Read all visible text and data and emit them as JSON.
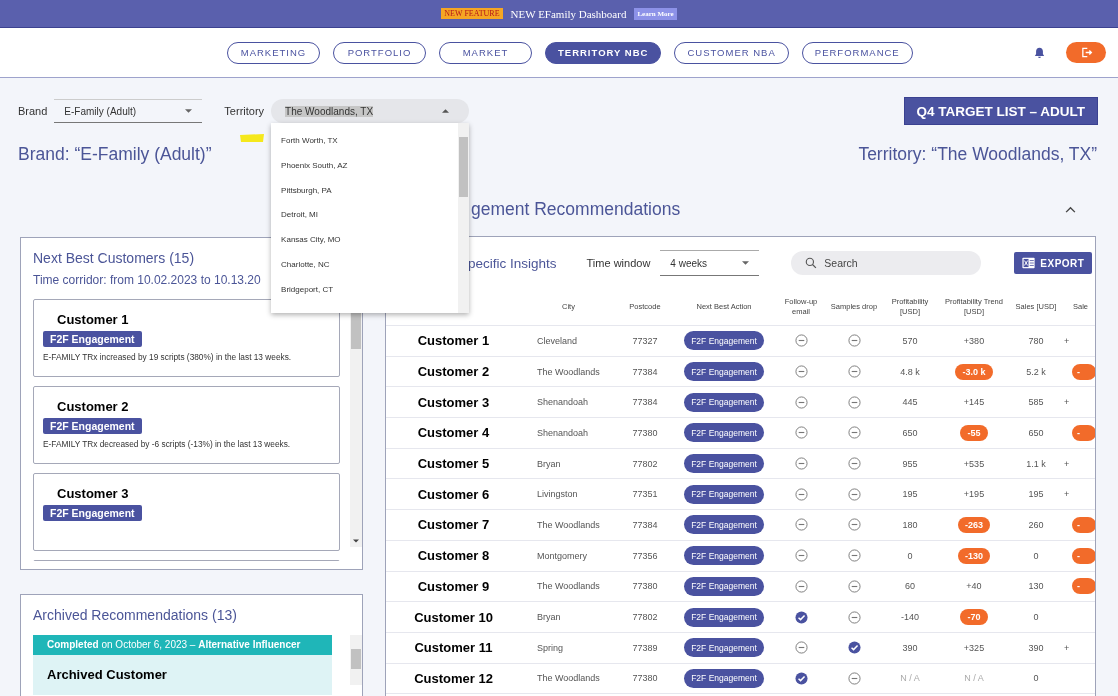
{
  "banner": {
    "badge": "NEW FEATURE",
    "text": "NEW EFamily Dashboard",
    "link": "Learn More"
  },
  "nav": {
    "tabs": [
      {
        "label": "MARKETING",
        "selected": false
      },
      {
        "label": "PORTFOLIO",
        "selected": false
      },
      {
        "label": "MARKET",
        "selected": false
      },
      {
        "label": "TERRITORY NBC",
        "selected": true
      },
      {
        "label": "CUSTOMER NBA",
        "selected": false
      },
      {
        "label": "PERFORMANCE",
        "selected": false
      }
    ]
  },
  "filters": {
    "brand": {
      "label": "Brand",
      "value": "E-Family (Adult)"
    },
    "territory": {
      "label": "Territory",
      "value": "The Woodlands, TX",
      "expanded": true,
      "options": [
        "Forth Worth, TX",
        "Phoenix South, AZ",
        "Pittsburgh, PA",
        "Detroit, MI",
        "Kansas City, MO",
        "Charlotte, NC",
        "Bridgeport, CT"
      ]
    }
  },
  "target_button": "Q4 TARGET LIST – ADULT",
  "brand_heading": "Brand: “E-Family (Adult)”",
  "territory_heading": "Territory: “The Woodlands, TX”",
  "section": {
    "title": "gement Recommendations",
    "expanded": true
  },
  "next_best": {
    "title": "Next Best Customers (15)",
    "subtitle": "Time corridor: from 10.02.2023 to 10.13.20",
    "cards": [
      {
        "name": "Customer 1",
        "action": "F2F Engagement",
        "note": "E-FAMILY TRx increased by 19 scripts (380%) in the last 13 weeks."
      },
      {
        "name": "Customer 2",
        "action": "F2F Engagement",
        "note": "E-FAMILY TRx decreased by -6 scripts (-13%) in the last 13 weeks."
      },
      {
        "name": "Customer 3",
        "action": "F2F Engagement"
      }
    ]
  },
  "archived": {
    "title": "Archived Recommendations (13)",
    "items": [
      {
        "header": "**Completed** on October 6, 2023 – **Alternative Influencer**",
        "name": "Archived Customer"
      }
    ]
  },
  "insights": {
    "title": "pecific Insights",
    "time_window": {
      "label": "Time window",
      "value": "4 weeks"
    },
    "search": {
      "placeholder": "Search"
    },
    "export": "EXPORT",
    "columns": [
      "City",
      "Postcode",
      "Next Best Action",
      "Follow-up email",
      "Samples drop",
      "Profitability [USD]",
      "Profitability Trend [USD]",
      "Sales [USD]",
      "Sale"
    ],
    "rows": [
      {
        "name": "Customer 1",
        "city": "Cleveland",
        "postcode": "77327",
        "action": "F2F Engagement",
        "followup_checked": false,
        "samples_checked": false,
        "profitability": "570",
        "trend": "+380",
        "trend_negative": false,
        "sales": "780",
        "column_10": {
          "text": "+",
          "negative": false
        }
      },
      {
        "name": "Customer 2",
        "city": "The Woodlands",
        "postcode": "77384",
        "action": "F2F Engagement",
        "followup_checked": false,
        "samples_checked": false,
        "profitability": "4.8 k",
        "trend": "-3.0 k",
        "trend_negative": true,
        "sales": "5.2 k",
        "column_10": {
          "text": "-",
          "negative": true
        }
      },
      {
        "name": "Customer 3",
        "city": "Shenandoah",
        "postcode": "77384",
        "action": "F2F Engagement",
        "followup_checked": false,
        "samples_checked": false,
        "profitability": "445",
        "trend": "+145",
        "trend_negative": false,
        "sales": "585",
        "column_10": {
          "text": "+",
          "negative": false
        }
      },
      {
        "name": "Customer 4",
        "city": "Shenandoah",
        "postcode": "77380",
        "action": "F2F Engagement",
        "followup_checked": false,
        "samples_checked": false,
        "profitability": "650",
        "trend": "-55",
        "trend_negative": true,
        "sales": "650",
        "column_10": {
          "text": "-",
          "negative": true
        }
      },
      {
        "name": "Customer 5",
        "city": "Bryan",
        "postcode": "77802",
        "action": "F2F Engagement",
        "followup_checked": false,
        "samples_checked": false,
        "profitability": "955",
        "trend": "+535",
        "trend_negative": false,
        "sales": "1.1 k",
        "column_10": {
          "text": "+",
          "negative": false
        }
      },
      {
        "name": "Customer 6",
        "city": "Livingston",
        "postcode": "77351",
        "action": "F2F Engagement",
        "followup_checked": false,
        "samples_checked": false,
        "profitability": "195",
        "trend": "+195",
        "trend_negative": false,
        "sales": "195",
        "column_10": {
          "text": "+",
          "negative": false
        }
      },
      {
        "name": "Customer 7",
        "city": "The Woodlands",
        "postcode": "77384",
        "action": "F2F Engagement",
        "followup_checked": false,
        "samples_checked": false,
        "profitability": "180",
        "trend": "-263",
        "trend_negative": true,
        "sales": "260",
        "column_10": {
          "text": "-",
          "negative": true
        }
      },
      {
        "name": "Customer 8",
        "city": "Montgomery",
        "postcode": "77356",
        "action": "F2F Engagement",
        "followup_checked": false,
        "samples_checked": false,
        "profitability": "0",
        "trend": "-130",
        "trend_negative": true,
        "sales": "0",
        "column_10": {
          "text": "-",
          "negative": true
        }
      },
      {
        "name": "Customer 9",
        "city": "The Woodlands",
        "postcode": "77380",
        "action": "F2F Engagement",
        "followup_checked": false,
        "samples_checked": false,
        "profitability": "60",
        "trend": "+40",
        "trend_negative": false,
        "sales": "130",
        "column_10": {
          "text": "-",
          "negative": true
        }
      },
      {
        "name": "Customer 10",
        "city": "Bryan",
        "postcode": "77802",
        "action": "F2F Engagement",
        "followup_checked": true,
        "samples_checked": false,
        "profitability": "-140",
        "trend": "-70",
        "trend_negative": true,
        "sales": "0"
      },
      {
        "name": "Customer 11",
        "city": "Spring",
        "postcode": "77389",
        "action": "F2F Engagement",
        "followup_checked": false,
        "samples_checked": true,
        "profitability": "390",
        "trend": "+325",
        "trend_negative": false,
        "sales": "390",
        "column_10": {
          "text": "+",
          "negative": false
        }
      },
      {
        "name": "Customer 12",
        "city": "The Woodlands",
        "postcode": "77380",
        "action": "F2F Engagement",
        "followup_checked": true,
        "samples_checked": false,
        "profitability": "N / A",
        "profitability_muted": true,
        "trend": "N / A",
        "trend_negative": false,
        "trend_muted": true,
        "sales": "0"
      }
    ]
  }
}
